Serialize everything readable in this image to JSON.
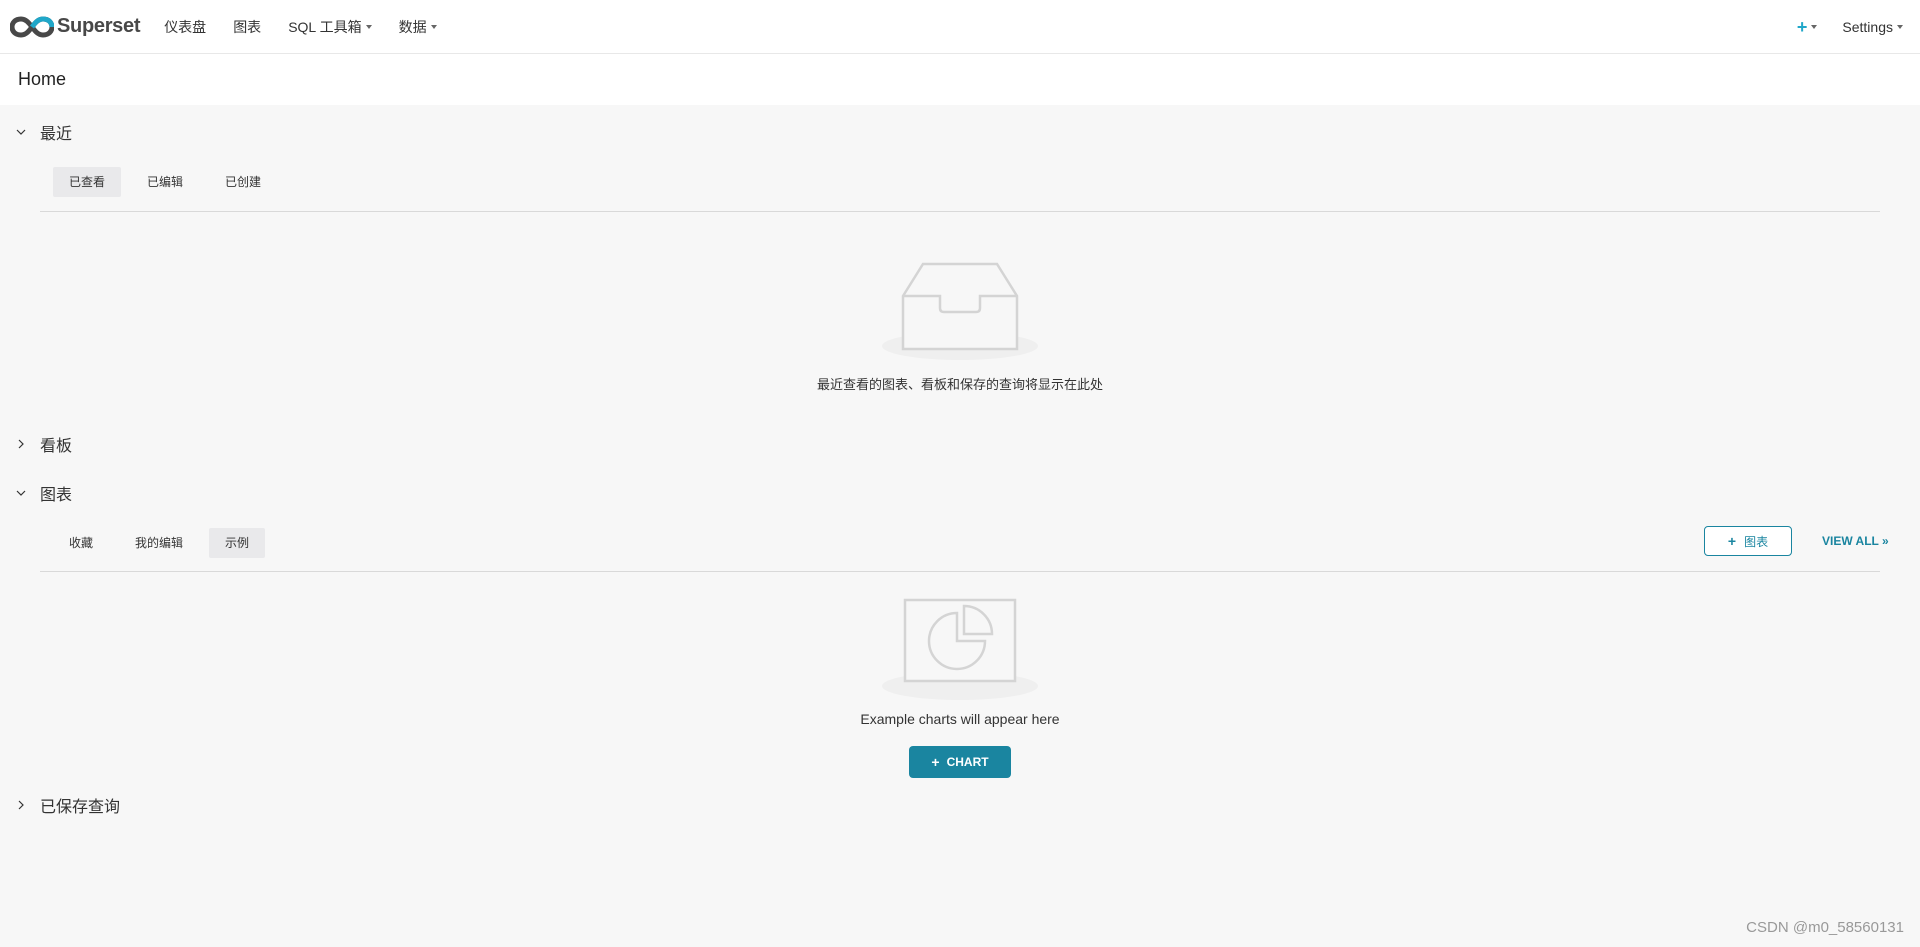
{
  "navbar": {
    "brand": "Superset",
    "menu": [
      {
        "label": "仪表盘",
        "dropdown": false
      },
      {
        "label": "图表",
        "dropdown": false
      },
      {
        "label": "SQL 工具箱",
        "dropdown": true
      },
      {
        "label": "数据",
        "dropdown": true
      }
    ],
    "settings_label": "Settings",
    "accent_color": "#20a7c9"
  },
  "home": {
    "title": "Home"
  },
  "recent": {
    "title": "最近",
    "expanded": true,
    "tabs": [
      "已查看",
      "已编辑",
      "已创建"
    ],
    "active_tab": 0,
    "empty_message": "最近查看的图表、看板和保存的查询将显示在此处"
  },
  "dashboards": {
    "title": "看板",
    "expanded": false
  },
  "charts": {
    "title": "图表",
    "expanded": true,
    "tabs": [
      "收藏",
      "我的编辑",
      "示例"
    ],
    "active_tab": 2,
    "add_button_label": "图表",
    "view_all_label": "VIEW ALL »",
    "empty_message": "Example charts will appear here",
    "create_button_label": "CHART",
    "button_color": "#1a85a0"
  },
  "saved_queries": {
    "title": "已保存查询",
    "expanded": false
  },
  "watermark": "CSDN @m0_58560131"
}
